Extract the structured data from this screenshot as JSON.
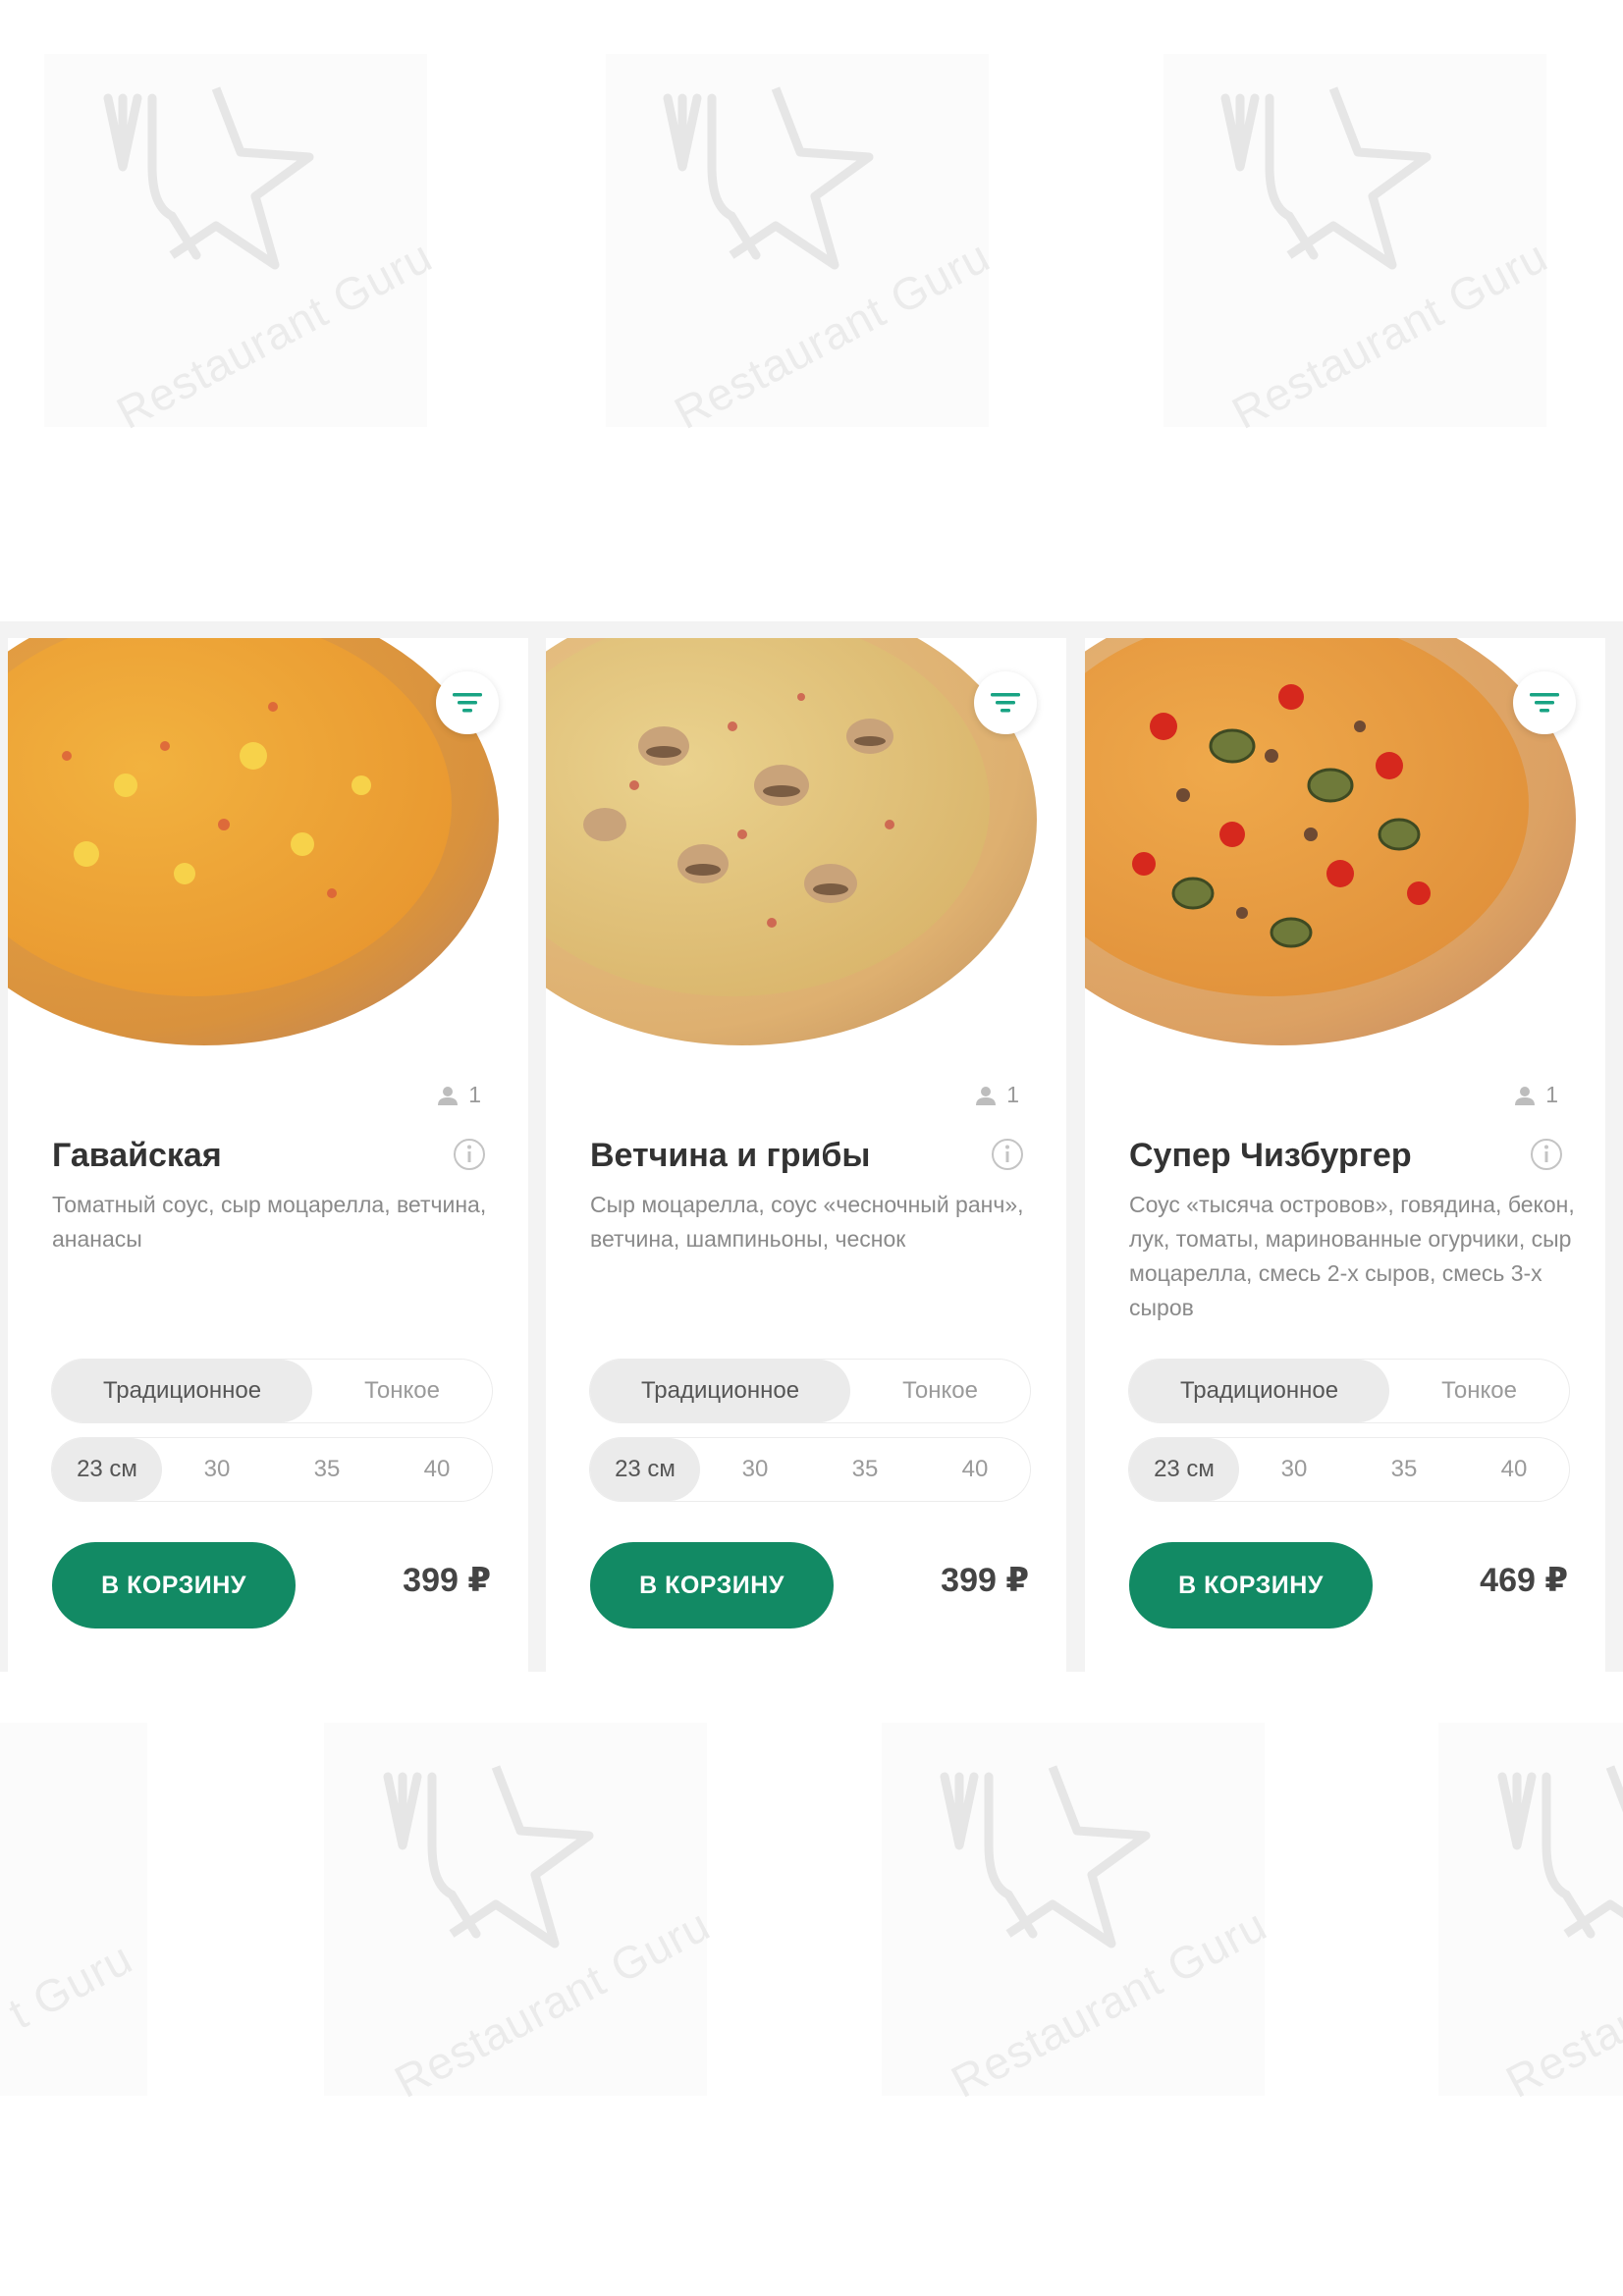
{
  "watermark": {
    "brand": "Restaurant Guru",
    "partial_left": "t Guru",
    "partial_right": "Restau"
  },
  "colors": {
    "accent": "#128a64",
    "filter_icon": "#18a383"
  },
  "products": [
    {
      "name": "Гавайская",
      "description": "Томатный соус, сыр моцарелла, ветчина, ананасы",
      "persons": "1",
      "dough_options": [
        "Традиционное",
        "Тонкое"
      ],
      "dough_selected": "Традиционное",
      "sizes": [
        "23 см",
        "30",
        "35",
        "40"
      ],
      "size_selected": "23 см",
      "cart_label": "В КОРЗИНУ",
      "price": "399 ₽",
      "icons": {
        "filter": "filter-icon",
        "person": "person-icon",
        "info": "info-icon"
      }
    },
    {
      "name": "Ветчина и грибы",
      "description": "Сыр моцарелла, соус «чесночный ранч», ветчина, шампиньоны, чеснок",
      "persons": "1",
      "dough_options": [
        "Традиционное",
        "Тонкое"
      ],
      "dough_selected": "Традиционное",
      "sizes": [
        "23 см",
        "30",
        "35",
        "40"
      ],
      "size_selected": "23 см",
      "cart_label": "В КОРЗИНУ",
      "price": "399 ₽",
      "icons": {
        "filter": "filter-icon",
        "person": "person-icon",
        "info": "info-icon"
      }
    },
    {
      "name": "Супер Чизбургер",
      "description": "Соус «тысяча островов», говядина, бекон, лук, томаты, маринованные огурчики, сыр моцарелла, смесь 2-х сыров, смесь 3-х сыров",
      "persons": "1",
      "dough_options": [
        "Традиционное",
        "Тонкое"
      ],
      "dough_selected": "Традиционное",
      "sizes": [
        "23 см",
        "30",
        "35",
        "40"
      ],
      "size_selected": "23 см",
      "cart_label": "В КОРЗИНУ",
      "price": "469 ₽",
      "icons": {
        "filter": "filter-icon",
        "person": "person-icon",
        "info": "info-icon"
      }
    }
  ]
}
